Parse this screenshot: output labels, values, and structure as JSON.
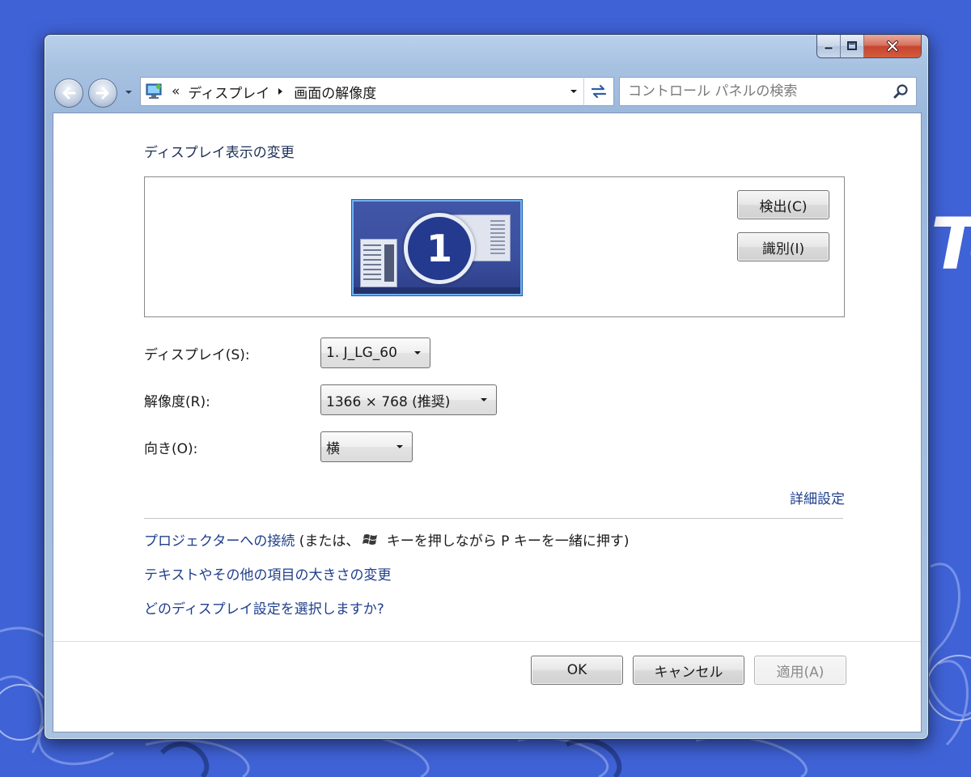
{
  "window": {
    "caption_buttons": {
      "minimize_icon": "minimize-icon",
      "maximize_icon": "maximize-icon",
      "close_icon": "close-icon"
    }
  },
  "nav": {
    "chevrons": "«",
    "breadcrumb": [
      "ディスプレイ",
      "画面の解像度"
    ],
    "search_placeholder": "コントロール パネルの検索"
  },
  "page": {
    "title": "ディスプレイ表示の変更",
    "monitor_number": "1",
    "detect_button": "検出(C)",
    "identify_button": "識別(I)"
  },
  "form": {
    "display_label": "ディスプレイ(S):",
    "display_value": "1. J_LG_60",
    "resolution_label": "解像度(R):",
    "resolution_value": "1366 × 768 (推奨)",
    "orientation_label": "向き(O):",
    "orientation_value": "横"
  },
  "links": {
    "advanced": "詳細設定",
    "projector_link": "プロジェクターへの接続",
    "projector_hint_before": " (または、",
    "projector_hint_after": " キーを押しながら P キーを一緒に押す)",
    "text_size": "テキストやその他の項目の大きさの変更",
    "which_display": "どのディスプレイ設定を選択しますか?"
  },
  "footer": {
    "ok": "OK",
    "cancel": "キャンセル",
    "apply": "適用(A)"
  },
  "colors": {
    "desktop": "#3f62d6",
    "link": "#1f3f8c",
    "title_text": "#1d2f56"
  },
  "wallpaper": {
    "logo_text": "Te"
  }
}
